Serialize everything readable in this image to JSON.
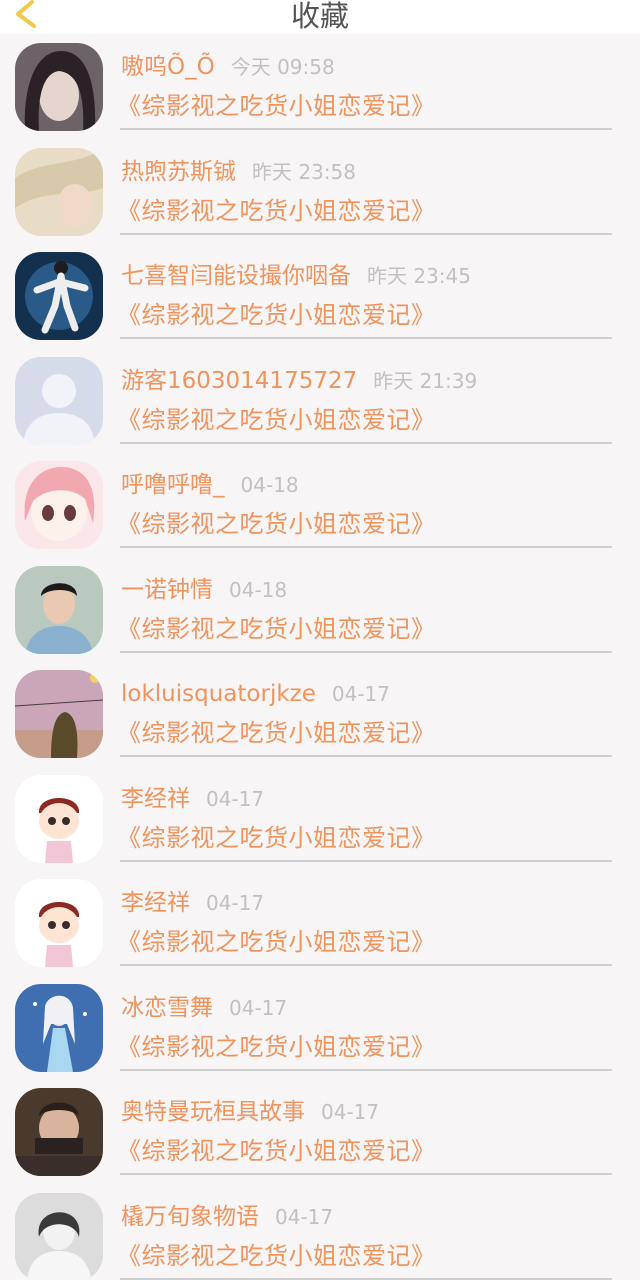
{
  "header": {
    "title": "收藏"
  },
  "colors": {
    "accent": "#f0945d",
    "back_icon": "#f3c84a",
    "time": "#c4c0c0"
  },
  "items": [
    {
      "name": "嗷呜Õ_Õ",
      "time": "今天 09:58",
      "book": "《综影视之吃货小姐恋爱记》",
      "avatar": "avatar-dark-haired-girl"
    },
    {
      "name": "热煦苏斯铖",
      "time": "昨天 23:58",
      "book": "《综影视之吃货小姐恋爱记》",
      "avatar": "avatar-soft-portrait"
    },
    {
      "name": "七喜智闫能设撮你咽备",
      "time": "昨天 23:45",
      "book": "《综影视之吃货小姐恋爱记》",
      "avatar": "avatar-dancer-on-stage"
    },
    {
      "name": "游客1603014175727",
      "time": "昨天 21:39",
      "book": "《综影视之吃货小姐恋爱记》",
      "avatar": "avatar-default-user"
    },
    {
      "name": "呼噜呼噜_",
      "time": "04-18",
      "book": "《综影视之吃货小姐恋爱记》",
      "avatar": "avatar-anime-pink-hair"
    },
    {
      "name": "一诺钟情",
      "time": "04-18",
      "book": "《综影视之吃货小姐恋爱记》",
      "avatar": "avatar-man-portrait"
    },
    {
      "name": "lokluisquatorjkze",
      "time": "04-17",
      "book": "《综影视之吃货小姐恋爱记》",
      "avatar": "avatar-illustrated-couple"
    },
    {
      "name": "李经祥",
      "time": "04-17",
      "book": "《综影视之吃货小姐恋爱记》",
      "avatar": "avatar-cartoon-boy"
    },
    {
      "name": "李经祥",
      "time": "04-17",
      "book": "《综影视之吃货小姐恋爱记》",
      "avatar": "avatar-cartoon-boy"
    },
    {
      "name": "冰恋雪舞",
      "time": "04-17",
      "book": "《综影视之吃货小姐恋爱记》",
      "avatar": "avatar-ice-princess"
    },
    {
      "name": "奥特曼玩桓具故事",
      "time": "04-17",
      "book": "《综影视之吃货小姐恋爱记》",
      "avatar": "avatar-group-photo"
    },
    {
      "name": "橇万旬象物语",
      "time": "04-17",
      "book": "《综影视之吃货小姐恋爱记》",
      "avatar": "avatar-girl-black-white"
    }
  ]
}
